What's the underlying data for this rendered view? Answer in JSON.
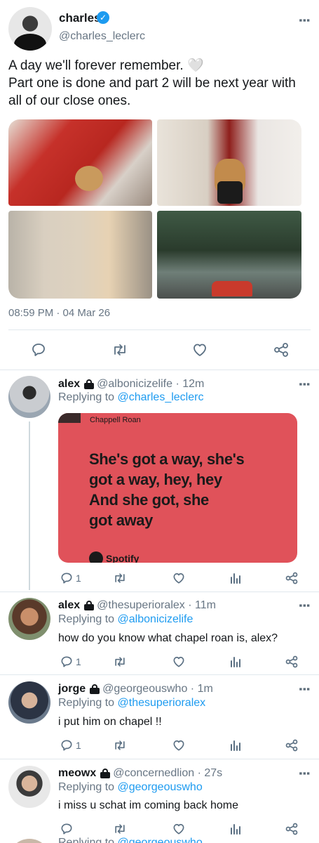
{
  "main_tweet": {
    "name": "charles",
    "verified_mark": "✓",
    "handle": "@charles_leclerc",
    "text": "A day we'll forever remember. 🤍\nPart one is done and part 2 will be next year with all of our close ones.",
    "timestamp": "08:59 PM · 04 Mar 26"
  },
  "more_icon": "⋮",
  "replies": [
    {
      "name": "alex",
      "handle": "@albonicizelife",
      "time": "· 12m",
      "replying_label": "Replying to",
      "replying_to": "@charles_leclerc",
      "text": "",
      "reply_count": "1",
      "card": {
        "artist": "Chappell Roan",
        "lyrics": "She's got a way, she's\ngot a way, hey, hey\nAnd she got, she\ngot away",
        "brand": "Spotify"
      }
    },
    {
      "name": "alex",
      "handle": "@thesuperioralex",
      "time": "· 11m",
      "replying_label": "Replying to",
      "replying_to": "@albonicizelife",
      "text": "how do you know what chapel roan is, alex?",
      "reply_count": "1"
    },
    {
      "name": "jorge",
      "handle": "@georgeouswho",
      "time": "· 1m",
      "replying_label": "Replying to",
      "replying_to": "@thesuperioralex",
      "text": "i put him on chapel !!",
      "reply_count": "1"
    },
    {
      "name": "meowx",
      "handle": "@concernedlion",
      "time": "· 27s",
      "replying_label": "Replying to",
      "replying_to": "@georgeouswho",
      "text": "i miss u schat im coming back home",
      "reply_count": ""
    }
  ],
  "cutoff": {
    "replying_label": "Replying to",
    "replying_to": "@georgeouswho"
  },
  "colors": {
    "accent": "#1d9bf0",
    "secondary_text": "#687684",
    "card_background": "#e0525a"
  },
  "icons": {
    "reply": "reply-icon",
    "retweet": "retweet-icon",
    "like": "heart-icon",
    "views": "views-icon",
    "share": "share-icon",
    "lock": "lock-icon",
    "verified": "verified-icon"
  }
}
